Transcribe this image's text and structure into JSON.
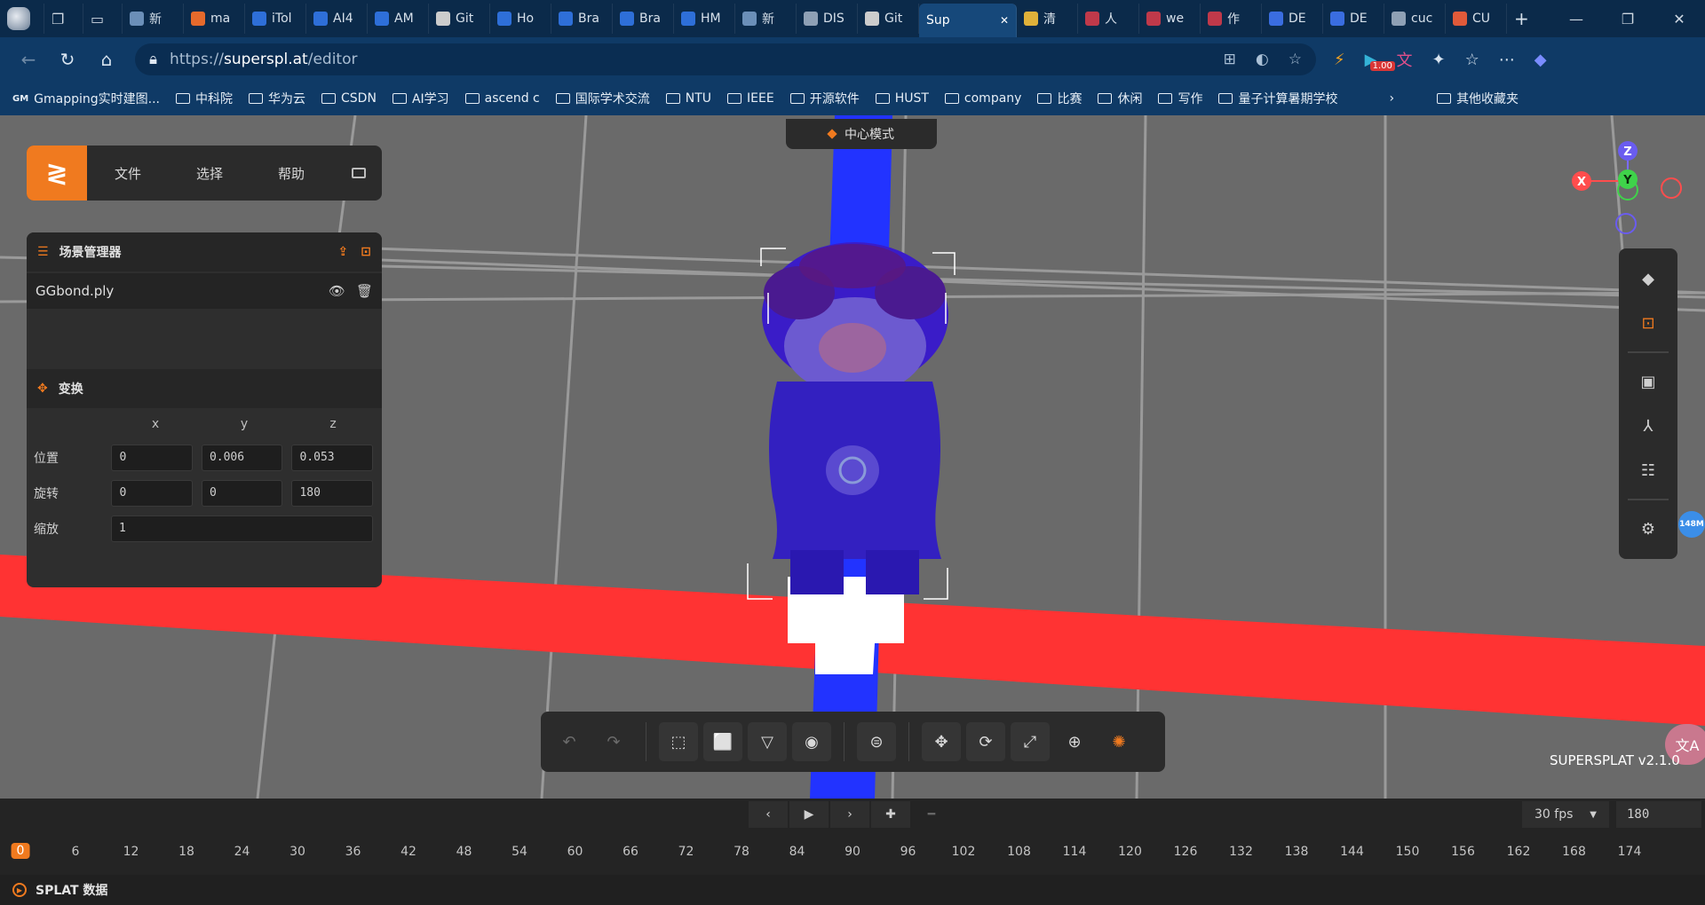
{
  "browser": {
    "tabs": [
      {
        "label": "新",
        "icon": "doc-icon",
        "color": "#6b8fb8"
      },
      {
        "label": "ma",
        "icon": "spinner-icon",
        "color": "#e66a2c"
      },
      {
        "label": "iTol",
        "icon": "k-icon",
        "color": "#2e6fd8"
      },
      {
        "label": "AI4",
        "icon": "k-icon",
        "color": "#2e6fd8"
      },
      {
        "label": "AM",
        "icon": "k-icon",
        "color": "#2e6fd8"
      },
      {
        "label": "Git",
        "icon": "github-icon",
        "color": "#cccccc"
      },
      {
        "label": "Ho",
        "icon": "k-icon",
        "color": "#2e6fd8"
      },
      {
        "label": "Bra",
        "icon": "k-icon",
        "color": "#2e6fd8"
      },
      {
        "label": "Bra",
        "icon": "k-icon",
        "color": "#2e6fd8"
      },
      {
        "label": "HM",
        "icon": "k-icon",
        "color": "#2e6fd8"
      },
      {
        "label": "新",
        "icon": "doc-icon",
        "color": "#6b8fb8"
      },
      {
        "label": "DIS",
        "icon": "cube-icon",
        "color": "#8ea0b5"
      },
      {
        "label": "Git",
        "icon": "github-icon",
        "color": "#cccccc"
      },
      {
        "label": "Sup",
        "icon": "none",
        "color": "#16487a",
        "active": true
      },
      {
        "label": "清",
        "icon": "cloud-icon",
        "color": "#e0b13a"
      },
      {
        "label": "人",
        "icon": "cube-icon",
        "color": "#c0394a"
      },
      {
        "label": "we",
        "icon": "pdf-icon",
        "color": "#c0394a"
      },
      {
        "label": "作",
        "icon": "cube-icon",
        "color": "#c0394a"
      },
      {
        "label": "DE",
        "icon": "stripes-icon",
        "color": "#3a6de0"
      },
      {
        "label": "DE",
        "icon": "stripes-icon",
        "color": "#3a6de0"
      },
      {
        "label": "cuc",
        "icon": "search-icon",
        "color": "#8ea0b5"
      },
      {
        "label": "CU",
        "icon": "puzzle-icon",
        "color": "#e05a3a"
      }
    ],
    "url_prefix": "https://",
    "url_host": "superspl.at",
    "url_path": "/editor",
    "zoom_badge": "1.00",
    "bookmarks": [
      "Gmapping实时建图...",
      "中科院",
      "华为云",
      "CSDN",
      "AI学习",
      "ascend c",
      "国际学术交流",
      "NTU",
      "IEEE",
      "开源软件",
      "HUST",
      "company",
      "比赛",
      "休闲",
      "写作",
      "量子计算暑期学校"
    ],
    "other_bookmarks": "其他收藏夹"
  },
  "editor": {
    "mode_label": "中心模式",
    "menu": {
      "file": "文件",
      "select": "选择",
      "help": "帮助"
    },
    "scene_manager": {
      "title": "场景管理器",
      "items": [
        {
          "name": "GGbond.ply"
        }
      ]
    },
    "transform": {
      "title": "变换",
      "axes": [
        "x",
        "y",
        "z"
      ],
      "position_label": "位置",
      "rotation_label": "旋转",
      "scale_label": "缩放",
      "position": [
        "0",
        "0.006",
        "0.053"
      ],
      "rotation": [
        "0",
        "0",
        "180"
      ],
      "scale": "1"
    },
    "gizmo": {
      "x": "X",
      "y": "Y",
      "z": "Z"
    },
    "memory_badge": "148M",
    "version": "SUPERSPLAT v2.1.0"
  },
  "timeline": {
    "fps": "30 fps",
    "frames": "180",
    "current_frame": "0",
    "ticks": [
      "6",
      "12",
      "18",
      "24",
      "30",
      "36",
      "42",
      "48",
      "54",
      "60",
      "66",
      "72",
      "78",
      "84",
      "90",
      "96",
      "102",
      "108",
      "114",
      "120",
      "126",
      "132",
      "138",
      "144",
      "150",
      "156",
      "162",
      "168",
      "174"
    ],
    "status_label": "SPLAT 数据"
  },
  "colors": {
    "accent": "#f07a1f",
    "axis_x": "#ff3333",
    "axis_z": "#2233ff"
  }
}
